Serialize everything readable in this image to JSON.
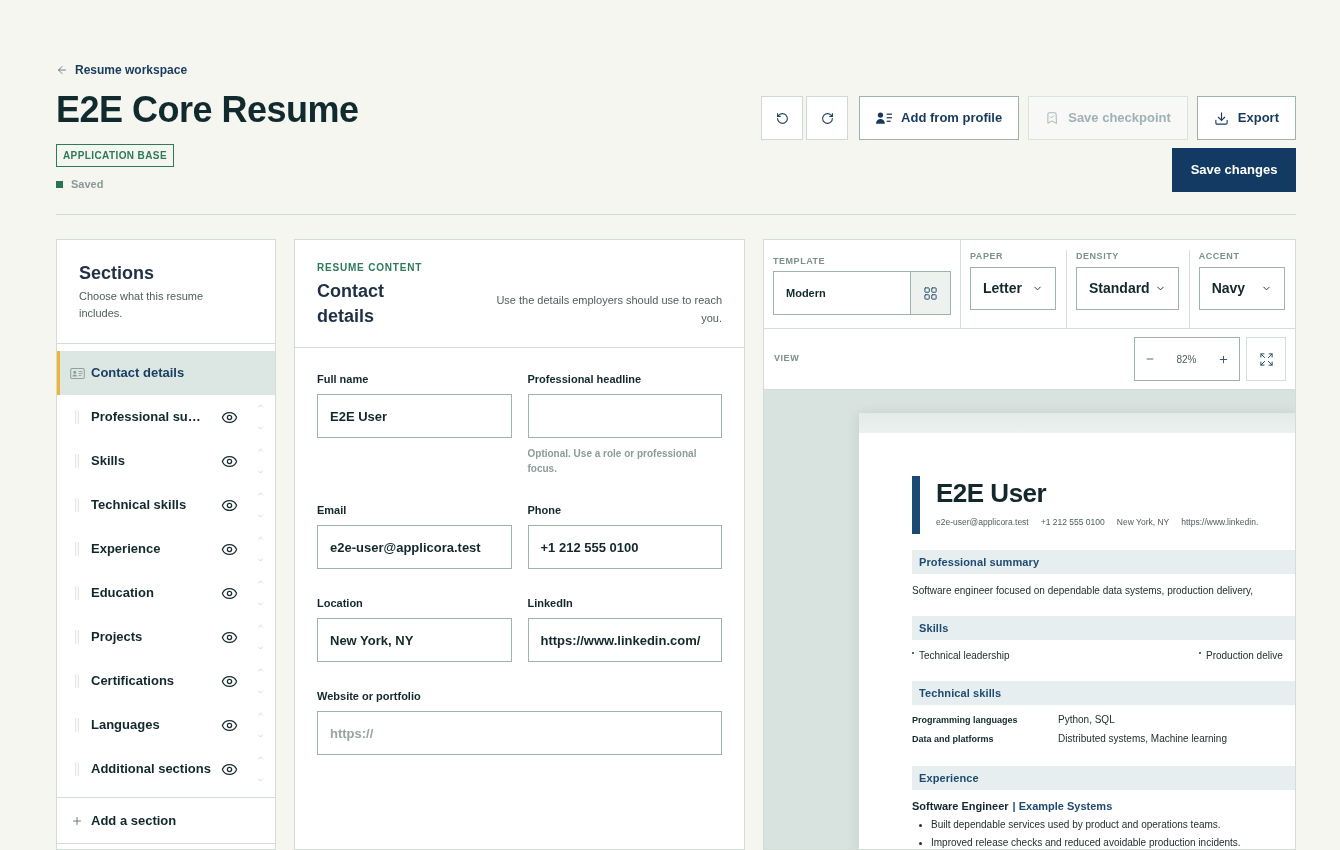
{
  "header": {
    "back_link": "Resume workspace",
    "title": "E2E Core Resume",
    "tag": "APPLICATION BASE",
    "save_status": "Saved"
  },
  "toolbar": {
    "buttons": [
      {
        "kind": "undo",
        "disabled": false
      },
      {
        "kind": "redo",
        "disabled": false
      },
      {
        "kind": "add_from_profile",
        "label": "Add from profile",
        "disabled": false
      },
      {
        "kind": "checkpoint",
        "label": "Save checkpoint",
        "disabled": true
      },
      {
        "kind": "export",
        "label": "Export",
        "disabled": false
      }
    ],
    "primary_button": "Save changes"
  },
  "sidebar": {
    "title": "Sections",
    "subtitle": "Choose what this resume includes.",
    "items": [
      {
        "kind": "fixed",
        "label": "Contact details",
        "selected": true
      },
      {
        "kind": "movable",
        "label": "Professional su…",
        "selected": false,
        "visible": true
      },
      {
        "kind": "movable",
        "label": "Skills",
        "selected": false,
        "visible": true
      },
      {
        "kind": "movable",
        "label": "Technical skills",
        "selected": false,
        "visible": true
      },
      {
        "kind": "movable",
        "label": "Experience",
        "selected": false,
        "visible": true
      },
      {
        "kind": "movable",
        "label": "Education",
        "selected": false,
        "visible": true
      },
      {
        "kind": "movable",
        "label": "Projects",
        "selected": false,
        "visible": true
      },
      {
        "kind": "movable",
        "label": "Certifications",
        "selected": false,
        "visible": true
      },
      {
        "kind": "movable",
        "label": "Languages",
        "selected": false,
        "visible": true
      },
      {
        "kind": "movable",
        "label": "Additional sections",
        "selected": false,
        "visible": true
      }
    ],
    "add_button": "Add a section"
  },
  "content": {
    "eyebrow": "RESUME CONTENT",
    "title": "Contact details",
    "description": "Use the details employers should use to reach you.",
    "rows": [
      [
        {
          "label": "Full name",
          "value": "E2E User"
        },
        {
          "label": "Professional headline",
          "hint": "Optional. Use a role or professional focus."
        }
      ],
      [
        {
          "label": "Email",
          "value": "e2e-user@applicora.test"
        },
        {
          "label": "Phone",
          "value": "+1 212 555 0100"
        }
      ],
      [
        {
          "label": "Location",
          "value": "New York, NY"
        },
        {
          "label": "LinkedIn",
          "value": "https://www.linkedin.com/"
        }
      ],
      [
        {
          "label": "Website or portfolio",
          "placeholder": "https://"
        }
      ]
    ]
  },
  "preview_panel": {
    "settings": [
      {
        "kind": "template",
        "label": "TEMPLATE",
        "value": "Modern"
      },
      {
        "kind": "select",
        "label": "PAPER",
        "value": "Letter"
      },
      {
        "kind": "select",
        "label": "DENSITY",
        "value": "Standard"
      },
      {
        "kind": "select",
        "label": "ACCENT",
        "value": "Navy"
      }
    ],
    "view": {
      "label": "VIEW",
      "zoom": "82%"
    },
    "resume": {
      "name": "E2E User",
      "contact": [
        "e2e-user@applicora.test",
        "+1 212 555 0100",
        "New York, NY",
        "https://www.linkedin."
      ],
      "sections": [
        {
          "kind": "paragraph",
          "title": "Professional summary",
          "text": "Software engineer focused on dependable data systems, production delivery,"
        },
        {
          "kind": "bullets",
          "title": "Skills",
          "items": [
            "Technical leadership",
            "Production delive"
          ]
        },
        {
          "kind": "table",
          "title": "Technical skills",
          "rows": [
            {
              "label": "Programming languages",
              "value": "Python, SQL"
            },
            {
              "label": "Data and platforms",
              "value": "Distributed systems, Machine learning"
            }
          ]
        },
        {
          "kind": "roles",
          "title": "Experience",
          "roles": [
            {
              "title": "Software Engineer",
              "company": "| Example Systems",
              "bullets": [
                "Built dependable services used by product and operations teams.",
                "Improved release checks and reduced avoidable production incidents."
              ]
            }
          ]
        }
      ]
    }
  }
}
